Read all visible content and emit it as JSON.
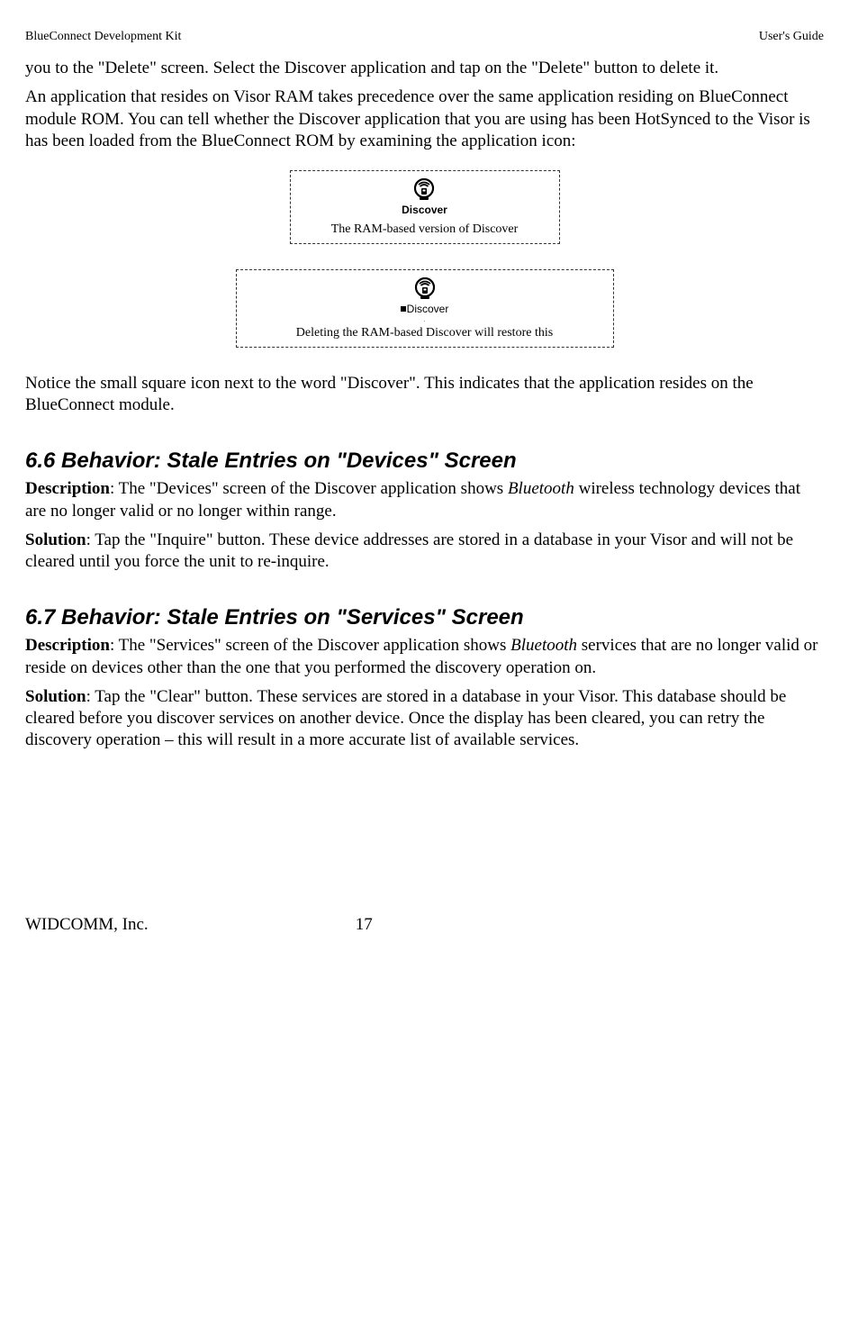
{
  "header": {
    "left": "BlueConnect Development Kit",
    "right": "User's Guide"
  },
  "intro": {
    "p1": "you to the \"Delete\" screen.  Select the Discover application and tap on the \"Delete\" button to delete it.",
    "p2": "An application that resides on Visor RAM takes precedence over the same application residing on BlueConnect module ROM. You can tell whether the Discover application that you are using has been HotSynced to the Visor is has been loaded from the BlueConnect ROM by examining the application icon:"
  },
  "fig1": {
    "icon_label": "Discover",
    "caption": "The RAM-based version of Discover"
  },
  "fig2": {
    "icon_label": "Discover",
    "caption": "Deleting the RAM-based Discover will restore this"
  },
  "after_fig": "Notice the small square icon next to the word \"Discover\".  This indicates that the application resides on the BlueConnect module.",
  "s66": {
    "heading": "6.6  Behavior:  Stale Entries on \"Devices\" Screen",
    "desc_label": "Description",
    "desc_1": ": The \"Devices\" screen of the Discover application shows ",
    "desc_em": "Bluetooth",
    "desc_2": " wireless technology devices that are no longer valid or no longer within range.",
    "sol_label": "Solution",
    "sol_text": ":  Tap the \"Inquire\" button.  These device addresses are stored in a database in your Visor and will not be cleared until you force the unit to re-inquire."
  },
  "s67": {
    "heading": "6.7  Behavior:  Stale Entries on \"Services\" Screen",
    "desc_label": "Description",
    "desc_1": ":  The \"Services\" screen of the Discover application shows ",
    "desc_em": "Bluetooth",
    "desc_2": " services that are no longer valid or reside on devices other than the one that you performed the discovery operation on.",
    "sol_label": "Solution",
    "sol_text": ":  Tap the \"Clear\" button.  These services are stored in a database in your Visor.  This database should be cleared before you discover services on another device. Once the display has been cleared, you can retry the discovery operation – this will result in a more accurate list of available services."
  },
  "footer": {
    "company": "WIDCOMM, Inc.",
    "page": "17"
  }
}
